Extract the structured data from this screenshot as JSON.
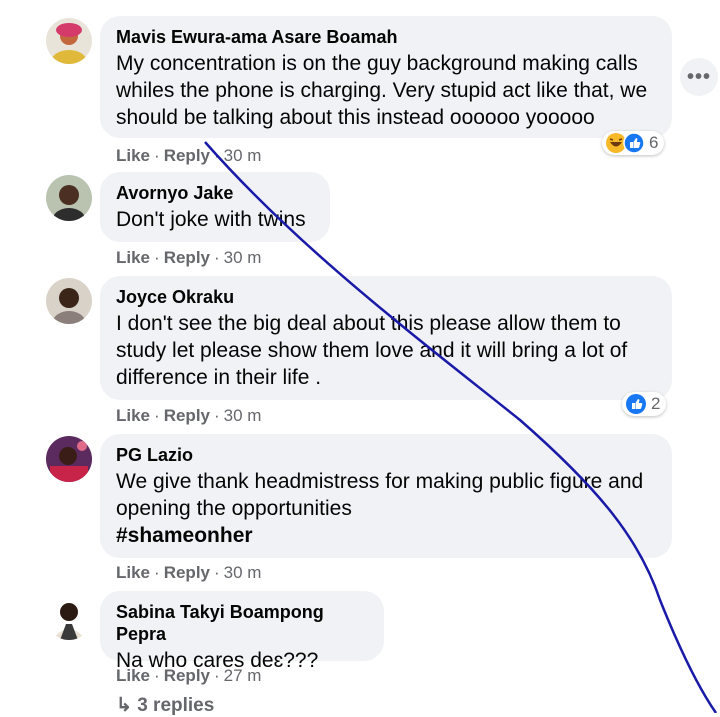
{
  "comments": [
    {
      "author": "Mavis Ewura-ama Asare Boamah",
      "text": [
        "My concentration is on the guy background making calls",
        "whiles the phone is charging. Very stupid act like that, we",
        "should be talking about this instead oooooo yooooo"
      ],
      "like": "Like",
      "reply": "Reply",
      "time": "30 m",
      "reactions": {
        "icons": [
          "haha-icon",
          "like-icon"
        ],
        "count": "6"
      }
    },
    {
      "author": "Avornyo Jake",
      "text": [
        "Don't joke with twins"
      ],
      "like": "Like",
      "reply": "Reply",
      "time": "30 m"
    },
    {
      "author": "Joyce Okraku",
      "text": [
        "I don't see the big deal about this please allow them to",
        "study let please show them love and it will bring a lot of",
        "difference in their life ."
      ],
      "like": "Like",
      "reply": "Reply",
      "time": "30 m",
      "reactions": {
        "icons": [
          "like-icon"
        ],
        "count": "2"
      }
    },
    {
      "author": "PG Lazio",
      "text": [
        "We give thank headmistress for making public figure and",
        "opening the opportunities"
      ],
      "hashtag": "#shameonher",
      "like": "Like",
      "reply": "Reply",
      "time": "30 m"
    },
    {
      "author": "Sabina Takyi Boampong Pepra",
      "text": [
        "Na who cares deɛ???"
      ],
      "like": "Like",
      "reply": "Reply",
      "time": "27 m"
    }
  ],
  "more_button": "•••",
  "view_replies": "↳ 3 replies",
  "colors": {
    "bubble": "#f0f2f5",
    "meta": "#65676b",
    "like_blue": "#1877f2",
    "haha_yellow": "#f7b928",
    "pen_stroke": "#1a1aa8"
  }
}
